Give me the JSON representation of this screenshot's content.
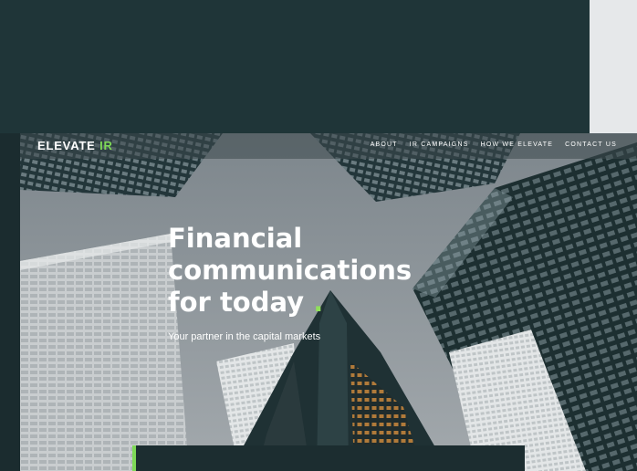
{
  "brand": {
    "logo_text": "ELEV",
    "logo_a": "A",
    "logo_tail": "TE",
    "logo_accent": "IR",
    "accent_color": "#7ed957"
  },
  "nav": {
    "items": [
      {
        "label": "ABOUT"
      },
      {
        "label": "IR CAMPAIGNS"
      },
      {
        "label": "HOW WE ELEVATE"
      },
      {
        "label": "CONTACT US"
      }
    ]
  },
  "hero": {
    "title_lines": [
      "Financial",
      "communications",
      "for today"
    ],
    "title_dot": ".",
    "subtitle": "Your partner in the capital markets",
    "background_image": "skyscrapers-looking-up"
  },
  "colors": {
    "top_band": "#1f3538",
    "side_panel": "#e6e8ea",
    "card": "#1c2d30"
  }
}
